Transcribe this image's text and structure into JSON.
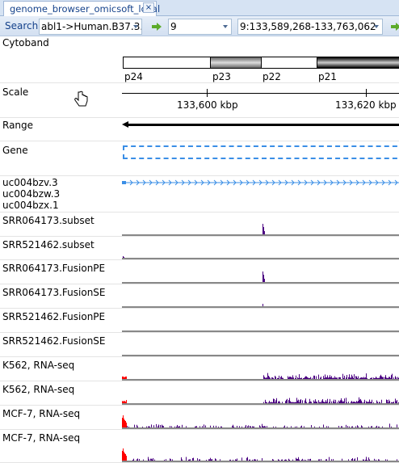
{
  "tab": {
    "title": "genome_browser_omicsoft_local",
    "close": "×"
  },
  "toolbar": {
    "search_label": "Search",
    "gene_combo": "abl1->Human.B37.3...",
    "chrom_combo": "9",
    "region_combo": "9:133,589,268-133,763,062"
  },
  "cytoband": {
    "label": "Cytoband",
    "bands": [
      {
        "name": "p24",
        "stain": "white"
      },
      {
        "name": "p23",
        "stain": "gray"
      },
      {
        "name": "p22",
        "stain": "white"
      },
      {
        "name": "p21",
        "stain": "black"
      }
    ]
  },
  "scale": {
    "label": "Scale",
    "ticks": [
      "133,600 kbp",
      "133,620 kbp"
    ]
  },
  "range": {
    "label": "Range"
  },
  "gene": {
    "label": "Gene"
  },
  "transcripts": {
    "label": "uc004bzv.3\nuc004bzw.3\nuc004bzx.1"
  },
  "tracks": [
    {
      "label": "SRR064173.subset",
      "type": "peak"
    },
    {
      "label": "SRR521462.subset",
      "type": "flat"
    },
    {
      "label": "SRR064173.FusionPE",
      "type": "peak"
    },
    {
      "label": "SRR064173.FusionSE",
      "type": "small"
    },
    {
      "label": "SRR521462.FusionPE",
      "type": "empty"
    },
    {
      "label": "SRR521462.FusionSE",
      "type": "empty"
    },
    {
      "label": "K562, RNA-seq",
      "type": "dense"
    },
    {
      "label": "K562, RNA-seq",
      "type": "dense"
    },
    {
      "label": "MCF-7, RNA-seq",
      "type": "sparse"
    },
    {
      "label": "MCF-7, RNA-seq",
      "type": "sparse"
    }
  ],
  "colors": {
    "signal": "#4b0082",
    "signal_start": "#ff0000",
    "gene_box": "#3a8ee6",
    "accent": "#15428b"
  }
}
